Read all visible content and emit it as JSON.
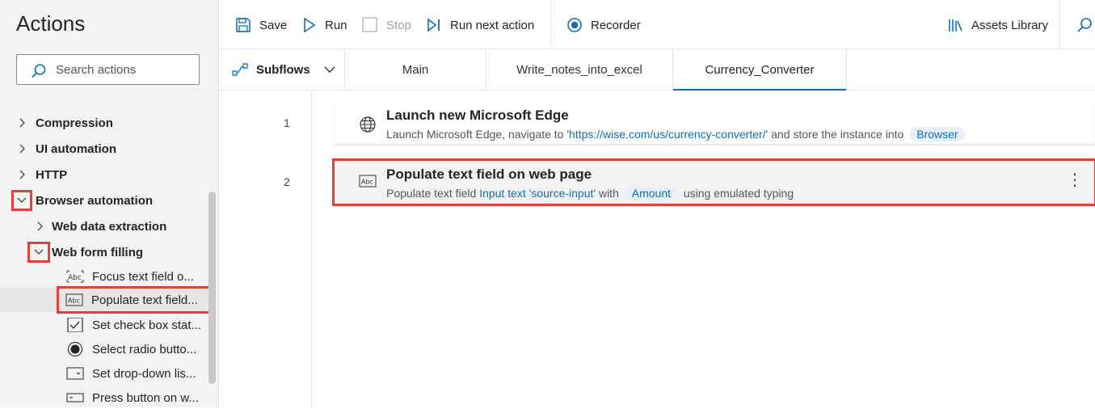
{
  "actions_pane": {
    "title": "Actions",
    "search_placeholder": "Search actions",
    "groups": [
      {
        "label": "Compression",
        "expanded": false
      },
      {
        "label": "UI automation",
        "expanded": false
      },
      {
        "label": "HTTP",
        "expanded": false
      },
      {
        "label": "Browser automation",
        "expanded": true
      },
      {
        "label": "Web data extraction",
        "expanded": false
      },
      {
        "label": "Web form filling",
        "expanded": true
      }
    ],
    "items": [
      {
        "label": "Focus text field o...",
        "icon": "text-field-icon"
      },
      {
        "label": "Populate text field...",
        "icon": "text-field-icon"
      },
      {
        "label": "Set check box stat...",
        "icon": "checkbox-icon"
      },
      {
        "label": "Select radio butto...",
        "icon": "radio-icon"
      },
      {
        "label": "Set drop-down lis...",
        "icon": "dropdown-icon"
      },
      {
        "label": "Press button on w...",
        "icon": "button-icon"
      }
    ]
  },
  "toolbar": {
    "save": "Save",
    "run": "Run",
    "stop": "Stop",
    "run_next": "Run next action",
    "recorder": "Recorder",
    "assets": "Assets Library"
  },
  "subflows": {
    "label": "Subflows",
    "tabs": [
      "Main",
      "Write_notes_into_excel",
      "Currency_Converter"
    ],
    "active_tab": "Currency_Converter"
  },
  "flow": {
    "actions": [
      {
        "line": "1",
        "title": "Launch new Microsoft Edge",
        "desc_prefix": "Launch Microsoft Edge, navigate to ",
        "desc_link": "'https://wise.com/us/currency-converter/'",
        "desc_mid": " and store the instance into ",
        "desc_var": "Browser"
      },
      {
        "line": "2",
        "title": "Populate text field on web page",
        "desc_prefix": "Populate text field ",
        "desc_link": "Input text 'source-input'",
        "desc_mid": " with ",
        "desc_var": "Amount",
        "desc_suffix": " using emulated typing"
      }
    ]
  },
  "colors": {
    "accent": "#0f6cbd",
    "highlight": "#e0413b",
    "pane_bg": "#f3f3f3"
  }
}
